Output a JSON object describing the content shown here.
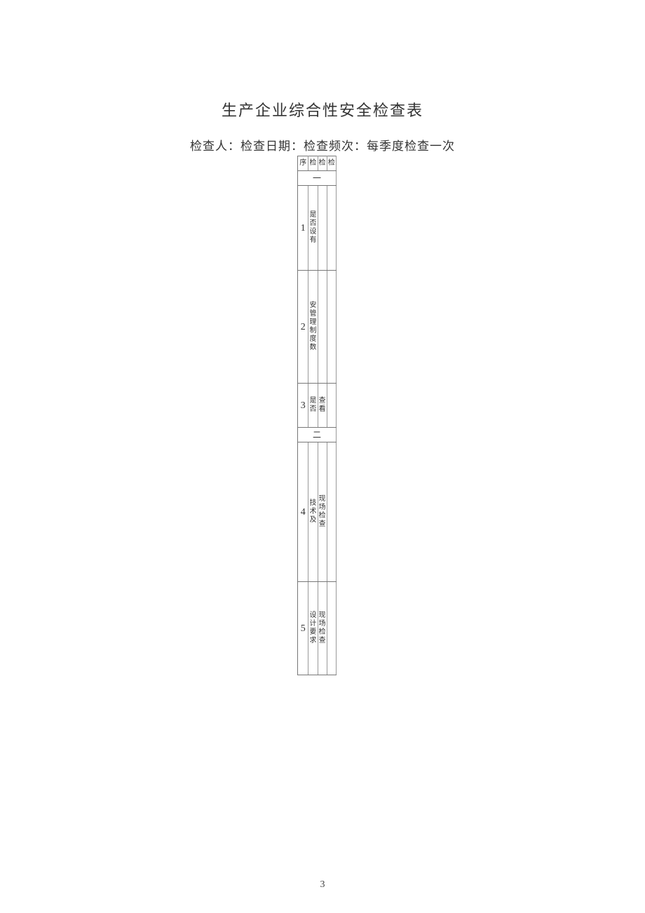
{
  "title": "生产企业综合性安全检查表",
  "subtitle": "检查人：检查日期：检查频次：每季度检查一次",
  "headers": {
    "seq": "序",
    "item": "检",
    "method": "检",
    "result": "检"
  },
  "sections": {
    "one": "一",
    "two": "二"
  },
  "rows": {
    "r1": {
      "seq": "1",
      "item": "是否设有",
      "method": "",
      "result": ""
    },
    "r2": {
      "seq": "2",
      "item": "安管理制度数",
      "method": "",
      "result": ""
    },
    "r3": {
      "seq": "3",
      "item": "是否",
      "method": "查看",
      "result": ""
    },
    "r4": {
      "seq": "4",
      "item": "技术及",
      "method": "现场检查",
      "result": ""
    },
    "r5": {
      "seq": "5",
      "item": "设计要求",
      "method": "现场检查",
      "result": ""
    }
  },
  "page_number": "3"
}
